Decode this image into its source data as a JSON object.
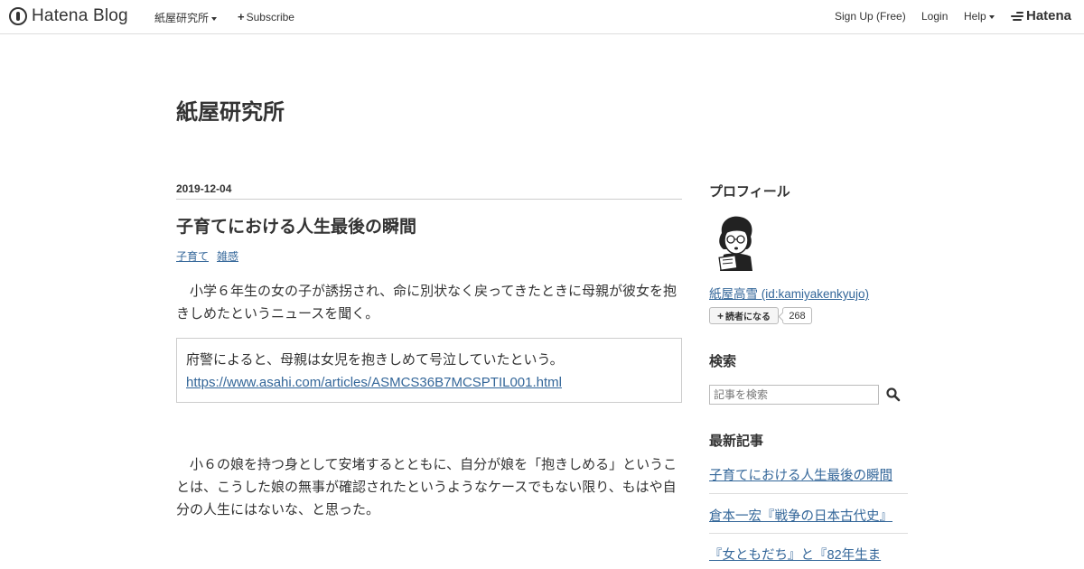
{
  "global_header": {
    "logo_text": "Hatena Blog",
    "blog_menu_label": "紙屋研究所",
    "subscribe_label": "Subscribe",
    "signup_label": "Sign Up (Free)",
    "login_label": "Login",
    "help_label": "Help",
    "hatena_label": "Hatena"
  },
  "blog": {
    "title": "紙屋研究所"
  },
  "article": {
    "date": "2019-12-04",
    "title": "子育てにおける人生最後の瞬間",
    "categories": [
      "子育て",
      "雑感"
    ],
    "paragraph1": "小学６年生の女の子が誘拐され、命に別状なく戻ってきたときに母親が彼女を抱きしめたというニュースを聞く。",
    "quote_text": "府警によると、母親は女児を抱きしめて号泣していたという。",
    "quote_link": "https://www.asahi.com/articles/ASMCS36B7MCSPTIL001.html",
    "paragraph2": "小６の娘を持つ身として安堵するとともに、自分が娘を「抱きしめる」ということは、こうした娘の無事が確認されたというようなケースでもない限り、もはや自分の人生にはないな、と思った。"
  },
  "sidebar": {
    "profile_heading": "プロフィール",
    "profile_name": "紙屋高雪 (id:kamiyakenkyujo)",
    "subscribe_button": "読者になる",
    "subscriber_count": "268",
    "search_heading": "検索",
    "search_placeholder": "記事を検索",
    "recent_heading": "最新記事",
    "recent_posts": [
      "子育てにおける人生最後の瞬間",
      "倉本一宏『戦争の日本古代史』",
      "『女ともだち』と『82年生ま"
    ]
  },
  "icons": {
    "hatena_blog_logo": "hatena-blog-logo-icon",
    "plus": "plus-icon",
    "dropdown": "caret-down-icon",
    "hatena_logo": "hatena-logo-icon",
    "search": "search-icon"
  }
}
